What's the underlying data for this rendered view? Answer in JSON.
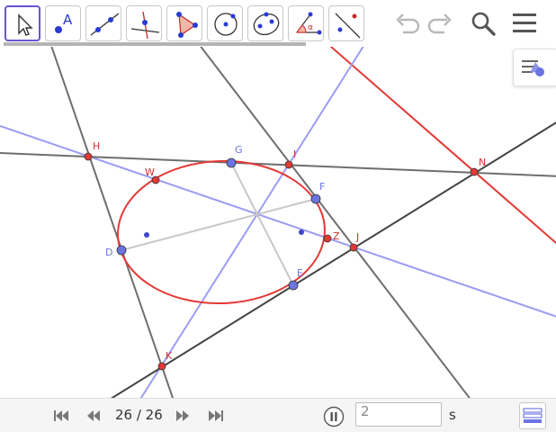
{
  "toolbar": {
    "tools": [
      {
        "id": "move",
        "icon": "cursor-arrow-icon",
        "active": true
      },
      {
        "id": "point",
        "icon": "point-icon",
        "label": "A"
      },
      {
        "id": "line",
        "icon": "line-through-points-icon"
      },
      {
        "id": "perpendicular",
        "icon": "perpendicular-line-icon"
      },
      {
        "id": "polygon",
        "icon": "polygon-icon"
      },
      {
        "id": "circle",
        "icon": "circle-center-point-icon"
      },
      {
        "id": "conic",
        "icon": "ellipse-icon"
      },
      {
        "id": "angle",
        "icon": "angle-icon",
        "label": "α"
      },
      {
        "id": "reflect",
        "icon": "reflect-line-icon"
      }
    ],
    "right_icons": [
      "undo-icon",
      "redo-icon",
      "search-icon",
      "menu-icon"
    ]
  },
  "points": {
    "H": {
      "label": "H",
      "color": "#d32f2f"
    },
    "I": {
      "label": "I",
      "color": "#d32f2f"
    },
    "N": {
      "label": "N",
      "color": "#d32f2f"
    },
    "W": {
      "label": "W",
      "color": "#d32f2f"
    },
    "Z": {
      "label": "Z",
      "color": "#d32f2f"
    },
    "J": {
      "label": "J",
      "color": "#d32f2f"
    },
    "K": {
      "label": "K",
      "color": "#d32f2f"
    },
    "G": {
      "label": "G",
      "color": "#6b74e0"
    },
    "F": {
      "label": "F",
      "color": "#6b74e0"
    },
    "D": {
      "label": "D",
      "color": "#6b74e0"
    },
    "E": {
      "label": "E",
      "color": "#6b74e0"
    }
  },
  "colors": {
    "red": "#e53935",
    "blue_line": "#9c9cf5",
    "gray_line": "#6e6e6e",
    "dark_line": "#444444",
    "light_gray": "#c8c8c8",
    "point_blue": "#6b74e0",
    "point_red": "#d32f2f",
    "accent": "#6557d2"
  },
  "playback": {
    "step": "26 / 26",
    "speed_value": "2",
    "speed_unit": "s"
  },
  "bottom_icons": [
    "skip-first-icon",
    "step-back-icon",
    "step-forward-icon",
    "skip-last-icon",
    "pause-icon",
    "algebra-input-icon"
  ]
}
